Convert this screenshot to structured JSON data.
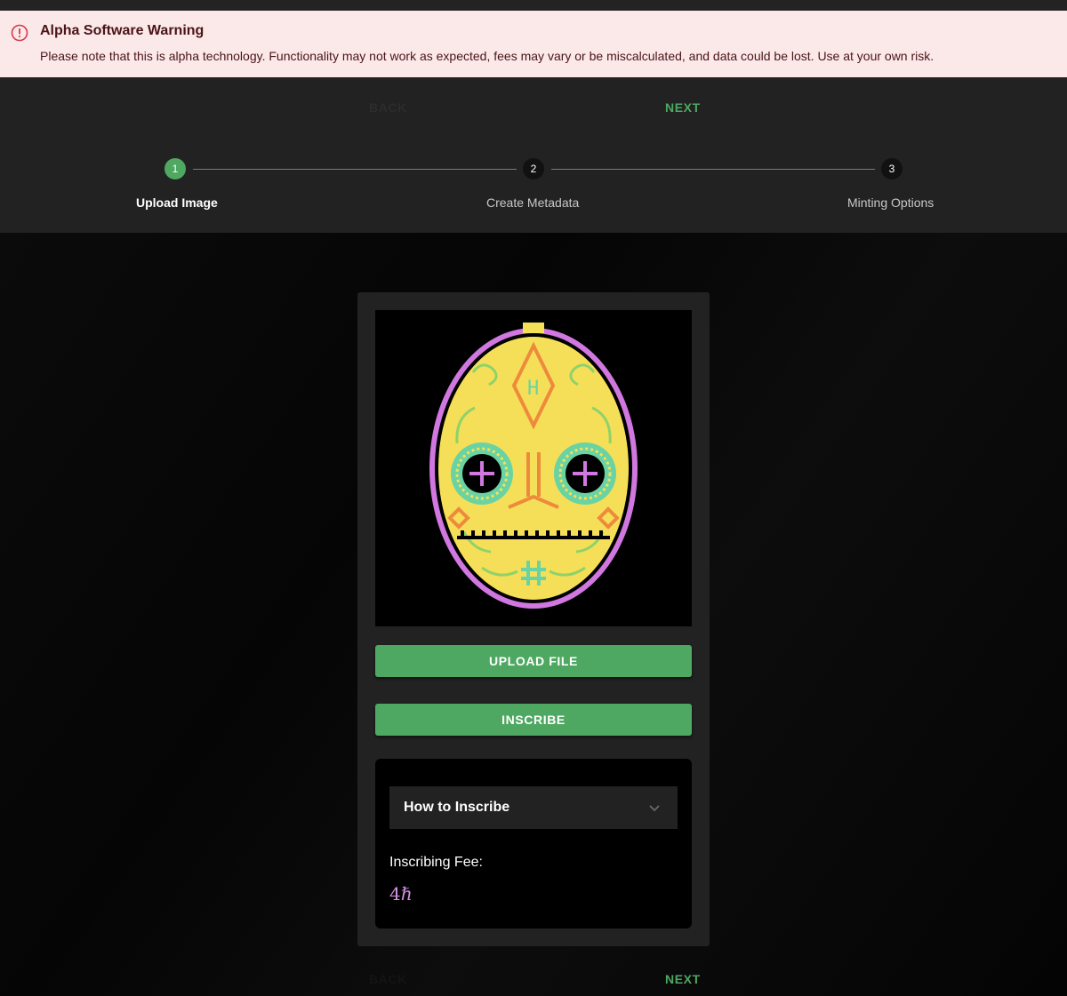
{
  "alert": {
    "title": "Alpha Software Warning",
    "message": "Please note that this is alpha technology. Functionality may not work as expected, fees may vary or be miscalculated, and data could be lost. Use at your own risk.",
    "icon": "error-outline-icon"
  },
  "nav": {
    "back_label": "BACK",
    "next_label": "NEXT"
  },
  "stepper": {
    "steps": [
      {
        "number": "1",
        "label": "Upload Image",
        "active": true
      },
      {
        "number": "2",
        "label": "Create Metadata",
        "active": false
      },
      {
        "number": "3",
        "label": "Minting Options",
        "active": false
      }
    ]
  },
  "card": {
    "preview_alt": "pixel art sugar skull mask",
    "upload_label": "UPLOAD FILE",
    "inscribe_label": "INSCRIBE",
    "accordion_title": "How to Inscribe",
    "fee_label": "Inscribing Fee:",
    "fee_value": "4ℏ"
  },
  "colors": {
    "accent_green": "#4ea861",
    "alert_bg": "#fbe8e9",
    "alert_icon": "#d9374b",
    "fee_purple": "#d891e8",
    "panel": "#222222"
  }
}
